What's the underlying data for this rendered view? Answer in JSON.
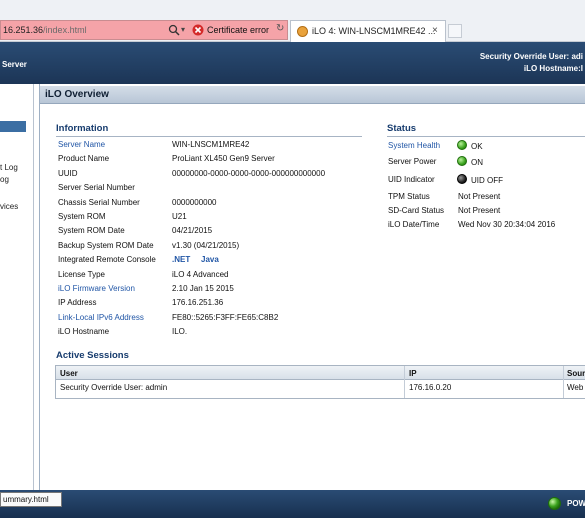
{
  "browser": {
    "url_host": "16.251.36",
    "url_path": "/index.html",
    "cert_error_label": "Certificate error",
    "tab_title": "iLO 4: WIN-LNSCM1MRE42 ...",
    "tab_close": "×",
    "dropdown_glyph": "▾",
    "reload_glyph": "↻"
  },
  "header": {
    "left_text": "Server",
    "right_line1": "Security Override User: adi",
    "right_line2": "iLO Hostname:I"
  },
  "sidebar": {
    "items": [
      "t Log",
      "og",
      "vices"
    ]
  },
  "panel": {
    "title": "iLO Overview"
  },
  "information": {
    "title": "Information",
    "rows": [
      {
        "label": "Server Name",
        "value": "WIN-LNSCM1MRE42",
        "label_link": true
      },
      {
        "label": "Product Name",
        "value": "ProLiant XL450 Gen9 Server",
        "label_link": false
      },
      {
        "label": "UUID",
        "value": "00000000-0000-0000-0000-000000000000",
        "label_link": false
      },
      {
        "label": "Server Serial Number",
        "value": "",
        "label_link": false
      },
      {
        "label": "Chassis Serial Number",
        "value": "0000000000",
        "label_link": false
      },
      {
        "label": "System ROM",
        "value": "U21",
        "label_link": false
      },
      {
        "label": "System ROM Date",
        "value": "04/21/2015",
        "label_link": false
      },
      {
        "label": "Backup System ROM Date",
        "value": "v1.30 (04/21/2015)",
        "label_link": false
      },
      {
        "label": "Integrated Remote Console",
        "value": "",
        "label_link": false
      },
      {
        "label": "License Type",
        "value": "iLO 4 Advanced",
        "label_link": false
      },
      {
        "label": "iLO Firmware Version",
        "value": "2.10 Jan 15 2015",
        "label_link": true
      },
      {
        "label": "IP Address",
        "value": "176.16.251.36",
        "label_link": false
      },
      {
        "label": "Link-Local IPv6 Address",
        "value": "FE80::5265:F3FF:FE65:C8B2",
        "label_link": true
      },
      {
        "label": "iLO Hostname",
        "value": "ILO.",
        "label_link": false
      }
    ],
    "console_links": [
      ".NET",
      "Java"
    ]
  },
  "status": {
    "title": "Status",
    "rows": [
      {
        "label": "System Health",
        "value": "OK",
        "label_link": true,
        "indicator": "green"
      },
      {
        "label": "Server Power",
        "value": "ON",
        "label_link": false,
        "indicator": "green"
      },
      {
        "label": "UID Indicator",
        "value": "UID OFF",
        "label_link": false,
        "indicator": "black"
      },
      {
        "label": "TPM Status",
        "value": "Not Present",
        "label_link": false,
        "indicator": ""
      },
      {
        "label": "SD-Card Status",
        "value": "Not Present",
        "label_link": false,
        "indicator": ""
      },
      {
        "label": "iLO Date/Time",
        "value": "Wed Nov 30 20:34:04 2016",
        "label_link": false,
        "indicator": ""
      }
    ]
  },
  "sessions": {
    "title": "Active Sessions",
    "columns": [
      "User",
      "IP",
      "Sour"
    ],
    "rows": [
      {
        "user": "Security Override User: admin",
        "ip": "176.16.0.20",
        "source": "Web"
      }
    ]
  },
  "footer": {
    "status_url": "ummary.html",
    "power_label": "POW"
  },
  "colors": {
    "header_blue": "#1c3556",
    "link_blue": "#2156a6",
    "section_blue": "#173c6e",
    "cert_error_red": "#f5a3a8"
  }
}
